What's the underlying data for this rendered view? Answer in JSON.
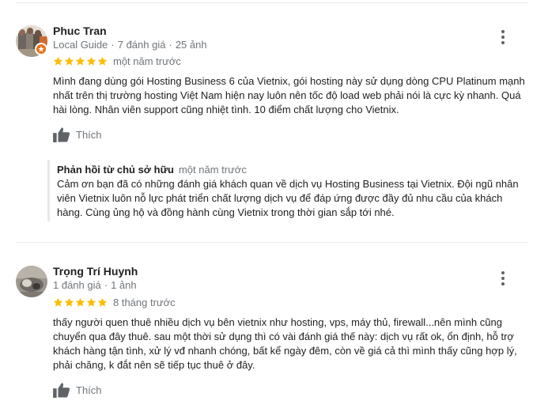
{
  "reviews": [
    {
      "author": "Phuc Tran",
      "meta_parts": [
        "Local Guide",
        "7 đánh giá",
        "25 ảnh"
      ],
      "rating": 5,
      "time": "một năm trước",
      "text": "Mình đang dùng gói Hosting Business 6 của Vietnix, gói hosting này sử dụng dòng CPU Platinum mạnh nhất trên thị trường hosting Việt Nam hiện nay luôn nên tốc độ load web phải nói là cực kỳ nhanh. Quá hài lòng. Nhân viên support cũng nhiệt tình. 10 điểm chất lượng cho Vietnix.",
      "like_label": "Thích",
      "local_guide_badge": true,
      "reply": {
        "title": "Phản hồi từ chủ sở hữu",
        "time": "một năm trước",
        "text": "Cảm ơn bạn đã có những đánh giá khách quan về dịch vụ Hosting Business tại Vietnix. Đội ngũ nhân viên Vietnix luôn nỗ lực phát triển chất lượng dịch vụ để đáp ứng được đầy đủ nhu cầu của khách hàng. Cùng ủng hộ và đồng hành cùng Vietnix trong thời gian sắp tới nhé."
      }
    },
    {
      "author": "Trọng Trí Huynh",
      "meta_parts": [
        "1 đánh giá",
        "1 ảnh"
      ],
      "rating": 5,
      "time": "8 tháng trước",
      "text": "thấy người quen thuê nhiều dịch vụ bên vietnix như hosting, vps, máy thủ, firewall...nên mình cũng chuyển qua đây thuê. sau một thời sử dụng thì có vài đánh giá thế này: dịch vụ rất ok, ổn định, hỗ trợ khách hàng tận tình, xử lý vđ nhanh chóng, bất kể ngày đêm, còn về giá cả thì mình thấy cũng hợp lý, phải chăng, k đắt nên sẽ tiếp tục thuê ở đây.",
      "like_label": "Thích",
      "local_guide_badge": false
    }
  ],
  "colors": {
    "star": "#fbbc04",
    "meta": "#70757a",
    "text": "#202124",
    "badge": "#e8711a",
    "divider": "#ebebeb"
  },
  "icons": {
    "more": "more-vert-icon",
    "like": "thumb-up-icon",
    "star": "star-icon",
    "badge": "local-guide-badge-icon"
  }
}
